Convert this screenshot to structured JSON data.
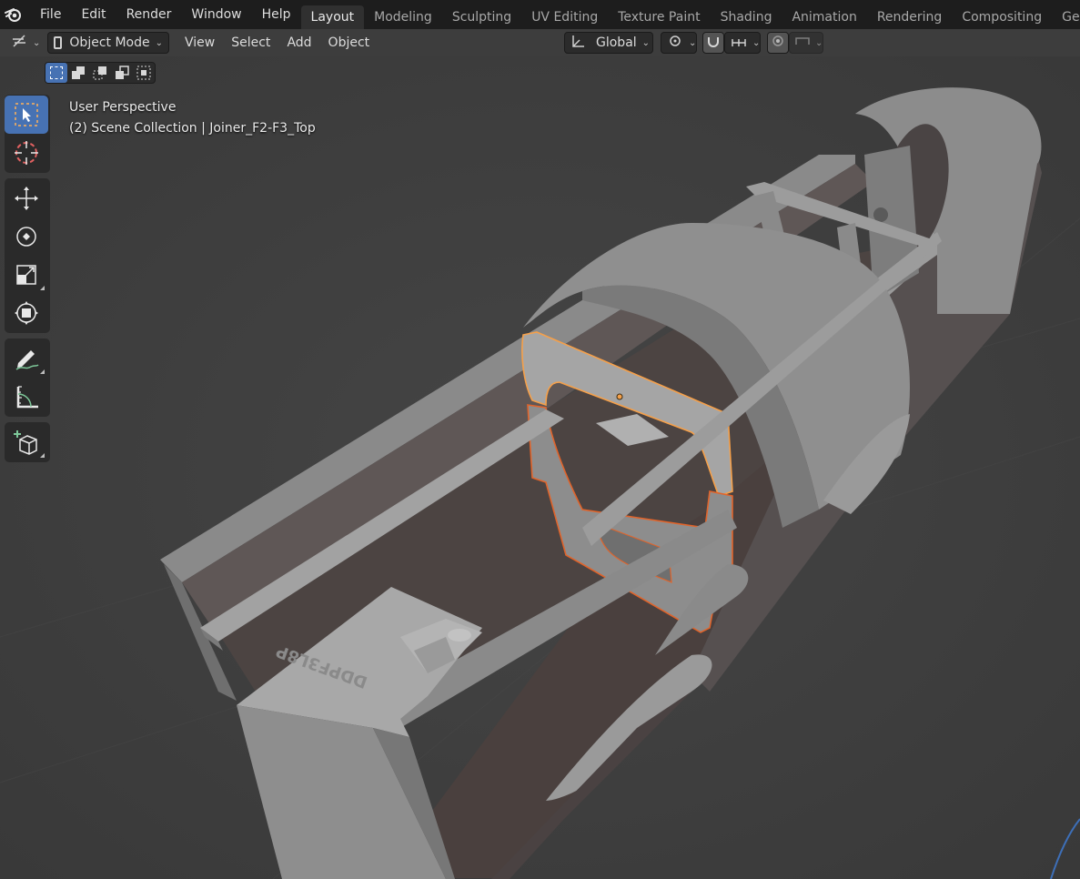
{
  "menu": {
    "items": [
      "File",
      "Edit",
      "Render",
      "Window",
      "Help"
    ]
  },
  "workspaces": {
    "tabs": [
      "Layout",
      "Modeling",
      "Sculpting",
      "UV Editing",
      "Texture Paint",
      "Shading",
      "Animation",
      "Rendering",
      "Compositing",
      "Geometry"
    ],
    "active": "Layout"
  },
  "header": {
    "mode_label": "Object Mode",
    "menus": [
      "View",
      "Select",
      "Add",
      "Object"
    ],
    "orientation_label": "Global"
  },
  "viewport": {
    "perspective_label": "User Perspective",
    "collection_label": "(2) Scene Collection | Joiner_F2-F3_Top",
    "engraved_text": "DDPF3L8P"
  },
  "colors": {
    "accent": "#4772b3",
    "selection_outline": "#f5a04a",
    "active_outline": "#e0642b",
    "background": "#3d3d3d"
  },
  "toolbar": {
    "tools": [
      "select-box-icon",
      "cursor-icon",
      "move-icon",
      "rotate-icon",
      "scale-icon",
      "transform-icon",
      "annotate-icon",
      "measure-icon",
      "add-cube-icon"
    ]
  }
}
